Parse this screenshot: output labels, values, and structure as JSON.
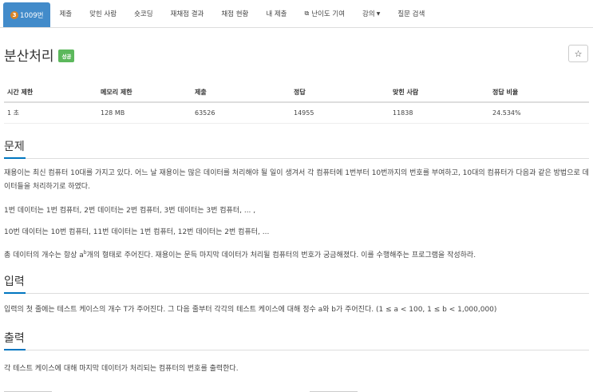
{
  "tabs": [
    {
      "key": "problem",
      "tier": "3",
      "label": "1009번"
    },
    {
      "key": "submit",
      "label": "제출"
    },
    {
      "key": "solvers",
      "label": "맞힌 사람"
    },
    {
      "key": "shortcoding",
      "label": "숏코딩"
    },
    {
      "key": "rejudge",
      "label": "재채점 결과"
    },
    {
      "key": "status",
      "label": "채점 현황"
    },
    {
      "key": "mysubmit",
      "label": "내 제출"
    },
    {
      "key": "difficulty",
      "label": "난이도 기여"
    },
    {
      "key": "lecture",
      "label": "강의"
    },
    {
      "key": "qna",
      "label": "질문 검색"
    }
  ],
  "title": "분산처리",
  "badge": "성공",
  "star": "☆",
  "stats": {
    "headers": [
      "시간 제한",
      "메모리 제한",
      "제출",
      "정답",
      "맞힌 사람",
      "정답 비율"
    ],
    "values": [
      "1 초",
      "128 MB",
      "63526",
      "14955",
      "11838",
      "24.534%"
    ]
  },
  "problem": {
    "heading": "문제",
    "p1": "재용이는 최신 컴퓨터 10대를 가지고 있다. 어느 날 재용이는 많은 데이터를 처리해야 될 일이 생겨서 각 컴퓨터에 1번부터 10번까지의 번호를 부여하고, 10대의 컴퓨터가 다음과 같은 방법으로 데이터들을 처리하기로 하였다.",
    "p2": "1번 데이터는 1번 컴퓨터, 2번 데이터는 2번 컴퓨터, 3번 데이터는 3번 컴퓨터, ... ,",
    "p3": "10번 데이터는 10번 컴퓨터, 11번 데이터는 1번 컴퓨터, 12번 데이터는 2번 컴퓨터, ...",
    "p4_a": "총 데이터의 개수는 항상 a",
    "p4_sup": "b",
    "p4_b": "개의 형태로 주어진다. 재용이는 문득 마지막 데이터가 처리될 컴퓨터의 번호가 궁금해졌다. 이를 수행해주는 프로그램을 작성하라."
  },
  "input": {
    "heading": "입력",
    "p1": "입력의 첫 줄에는 테스트 케이스의 개수 T가 주어진다. 그 다음 줄부터 각각의 테스트 케이스에 대해 정수 a와 b가 주어진다. (1 ≤ a < 100, 1 ≤ b < 1,000,000)"
  },
  "output": {
    "heading": "출력",
    "p1": "각 테스트 케이스에 대해 마지막 데이터가 처리되는 컴퓨터의 번호를 출력한다."
  }
}
